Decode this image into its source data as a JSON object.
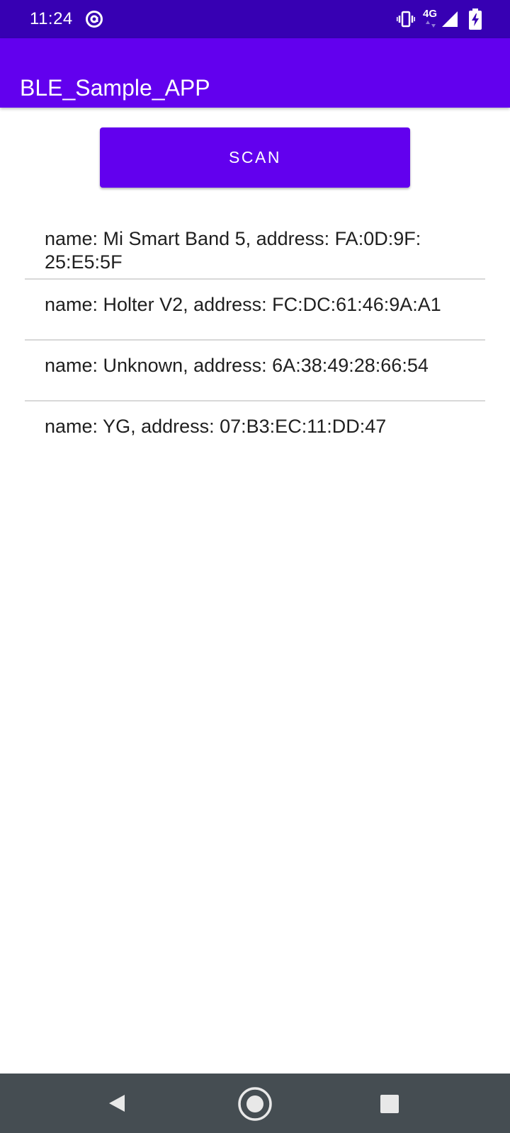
{
  "status_bar": {
    "time": "11:24",
    "network": "4G",
    "icons": [
      "at-sign-icon",
      "vibrate-icon",
      "data-arrows-icon",
      "signal-icon",
      "battery-icon"
    ]
  },
  "app_bar": {
    "title": "BLE_Sample_APP"
  },
  "scan_button": {
    "label": "SCAN"
  },
  "devices": [
    {
      "label": "name: Mi Smart Band 5, address: FA:0D:9F:\n25:E5:5F"
    },
    {
      "label": "name: Holter V2, address: FC:DC:61:46:9A:A1"
    },
    {
      "label": "name: Unknown, address: 6A:38:49:28:66:54"
    },
    {
      "label": "name: YG, address: 07:B3:EC:11:DD:47"
    }
  ],
  "nav_bar": {
    "icons": [
      "back-icon",
      "home-icon",
      "recents-icon"
    ]
  },
  "colors": {
    "status_bar": "#3700b3",
    "primary": "#6200ee",
    "nav_bar": "#454d52"
  }
}
